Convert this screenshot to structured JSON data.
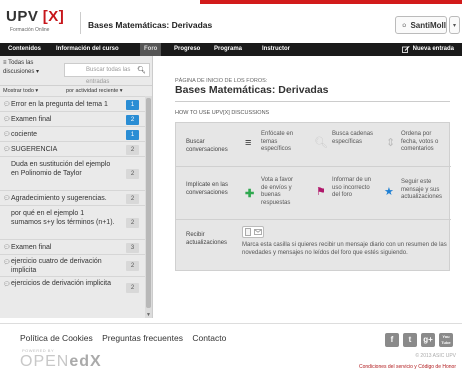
{
  "header": {
    "logo_text": "UPV",
    "logo_x": "[X]",
    "logo_sub": "Formación Online",
    "course_title": "Bases Matemáticas: Derivadas",
    "user_name": "SantiMoll",
    "user_dropdown": "▾"
  },
  "nav": {
    "tabs": [
      "Contenidos",
      "Información del curso",
      "Foro",
      "Progreso",
      "Programa",
      "Instructor"
    ],
    "new_post": "Nueva entrada"
  },
  "sidebar": {
    "all_discussions": "Todas las discusiones ▾",
    "search_placeholder": "Buscar todas las entradas",
    "filter_show": "Mostrar todo ▾",
    "filter_sort": "por actividad reciente ▾",
    "items": [
      {
        "title": "Error en la pregunta del tema 1",
        "count": "1",
        "new": true
      },
      {
        "title": "Examen final",
        "count": "2",
        "new": true
      },
      {
        "title": "cociente",
        "count": "1",
        "new": true
      },
      {
        "title": "SUGERENCIA",
        "count": "2",
        "new": false
      },
      {
        "title": "Duda en sustitución del ejemplo en Polinomio de Taylor",
        "count": "2",
        "new": false
      },
      {
        "title": "Agradecimiento y sugerencias.",
        "count": "2",
        "new": false
      },
      {
        "title": "por qué en el ejemplo 1 sumamos s+y los términos (n+1).",
        "count": "2",
        "new": false
      },
      {
        "title": "Examen final",
        "count": "3",
        "new": false
      },
      {
        "title": "ejercicio cuatro de derivación implicita",
        "count": "2",
        "new": false
      },
      {
        "title": "ejercicios de derivación implicita",
        "count": "2",
        "new": false
      }
    ]
  },
  "main": {
    "breadcrumb": "PÁGINA DE INICIO DE LOS FOROS:",
    "title": "Bases Matemáticas: Derivadas",
    "howto": "HOW TO USE UPV[X] DISCUSSIONS",
    "rows": [
      {
        "label": "Buscar conversaciones",
        "cells": [
          {
            "icon": "list-icon",
            "text": "Enfócate en temas específicos"
          },
          {
            "icon": "search-icon",
            "text": "Busca cadenas específicas"
          },
          {
            "icon": "sort-icon",
            "text": "Ordena por fecha, votos o comentarios"
          }
        ]
      },
      {
        "label": "Implícate en las conversaciones",
        "cells": [
          {
            "icon": "plus-icon",
            "text": "Vota a favor de envíos y buenas respuestas"
          },
          {
            "icon": "flag-icon",
            "text": "Informar de un uso incorrecto del foro"
          },
          {
            "icon": "star-icon",
            "text": "Seguir este mensaje y sus actualizaciones"
          }
        ]
      },
      {
        "label": "Recibir actualizaciones",
        "description": "Marca esta casilla si quieres recibir un mensaje diario con un resumen de las novedades y mensajes no leídos del foro que estés siguiendo."
      }
    ]
  },
  "footer": {
    "links": [
      "Política de Cookies",
      "Preguntas frecuentes",
      "Contacto"
    ],
    "powered_by": "POWERED BY",
    "openedx_a": "OPEN",
    "openedx_b": "edX",
    "copyright": "© 2013 ASIC UPV",
    "terms": "Condiciones del servicio y Código de Honor",
    "socials": [
      "f",
      "t",
      "g+",
      "You Tube"
    ]
  },
  "colors": {
    "brand_red": "#c7161b",
    "nav_bg": "#1a1a1a",
    "badge_new": "#2a8dd4",
    "accent_green": "#2fa84f",
    "accent_flag": "#b0186b",
    "accent_star": "#1e7fd4"
  }
}
